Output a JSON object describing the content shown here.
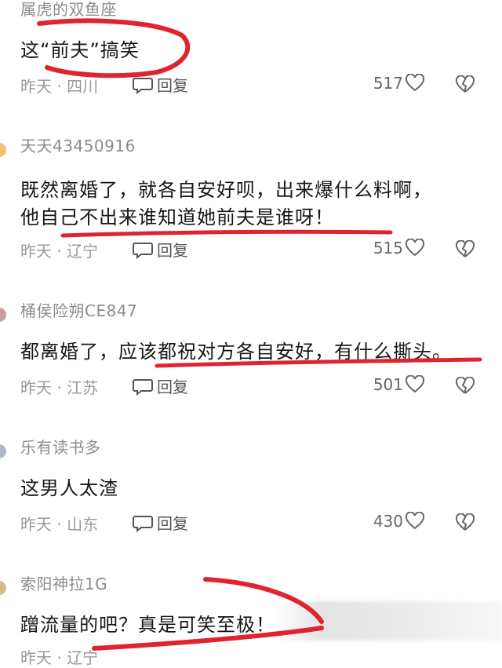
{
  "comments": [
    {
      "username": "属虎的双鱼座",
      "text": "这“前夫”搞笑",
      "meta": "昨天 · 四川",
      "reply_label": "回复",
      "likes": "517"
    },
    {
      "username": "天天43450916",
      "text_line1": "既然离婚了，就各自安好呗，出来爆什么料啊，",
      "text_line2": "他自己不出来谁知道她前夫是谁呀！",
      "meta": "昨天 · 辽宁",
      "reply_label": "回复",
      "likes": "515"
    },
    {
      "username": "桶侯险朔CE847",
      "text": "都离婚了，应该都祝对方各自安好，有什么撕头。",
      "meta": "昨天 · 江苏",
      "reply_label": "回复",
      "likes": "501"
    },
    {
      "username": "乐有读书多",
      "text": "这男人太渣",
      "meta": "昨天 · 山东",
      "reply_label": "回复",
      "likes": "430"
    },
    {
      "username": "索阳神拉1G",
      "text": "蹭流量的吧？真是可笑至极！",
      "meta": "昨天 · 辽宁"
    }
  ],
  "colors": {
    "annotation": "#e0242f",
    "meta_text": "#9a9a9a",
    "username": "#8c8c8c"
  },
  "icons": [
    "reply-bubble-icon",
    "heart-icon",
    "broken-heart-icon"
  ]
}
